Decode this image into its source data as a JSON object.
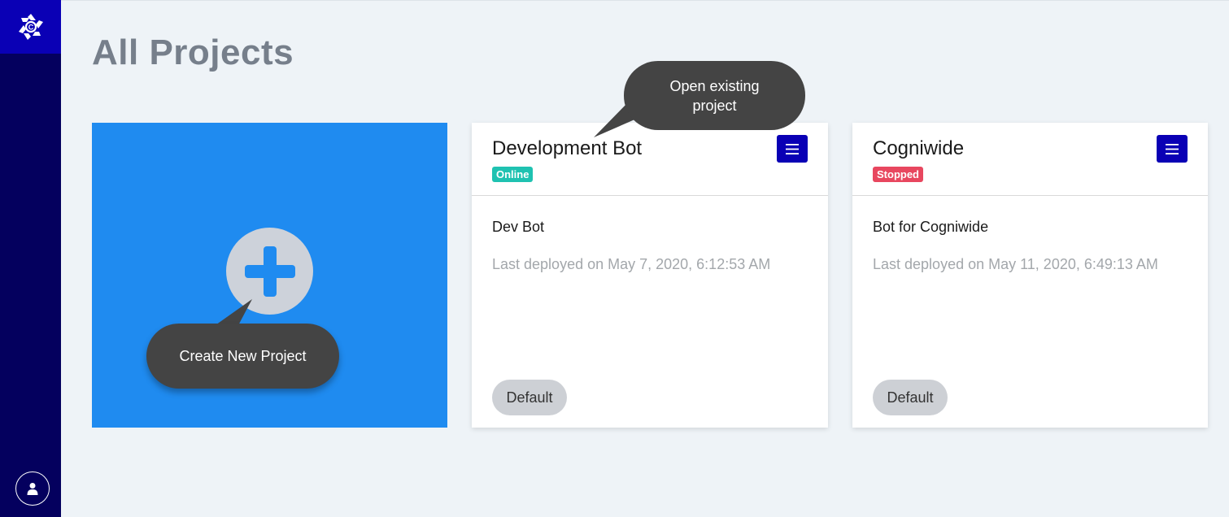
{
  "page": {
    "title": "All Projects"
  },
  "sidebar": {
    "logo_icon": "cogniwide-logo-icon",
    "user_icon": "user-icon"
  },
  "create_card": {
    "icon": "plus-icon",
    "tooltip": "Create New Project"
  },
  "tooltip_open": {
    "text": "Open existing project"
  },
  "projects": [
    {
      "name": "Development Bot",
      "status": "Online",
      "status_color": "#1fc2b1",
      "description": "Dev Bot",
      "last_deployed": "Last deployed on May 7, 2020, 6:12:53 AM",
      "environment": "Default"
    },
    {
      "name": "Cogniwide",
      "status": "Stopped",
      "status_color": "#e8475f",
      "description": "Bot for Cogniwide",
      "last_deployed": "Last deployed on May 11, 2020, 6:49:13 AM",
      "environment": "Default"
    }
  ],
  "colors": {
    "sidebar": "#04005e",
    "accent": "#0a00b5",
    "create_card": "#1f8bf0"
  }
}
